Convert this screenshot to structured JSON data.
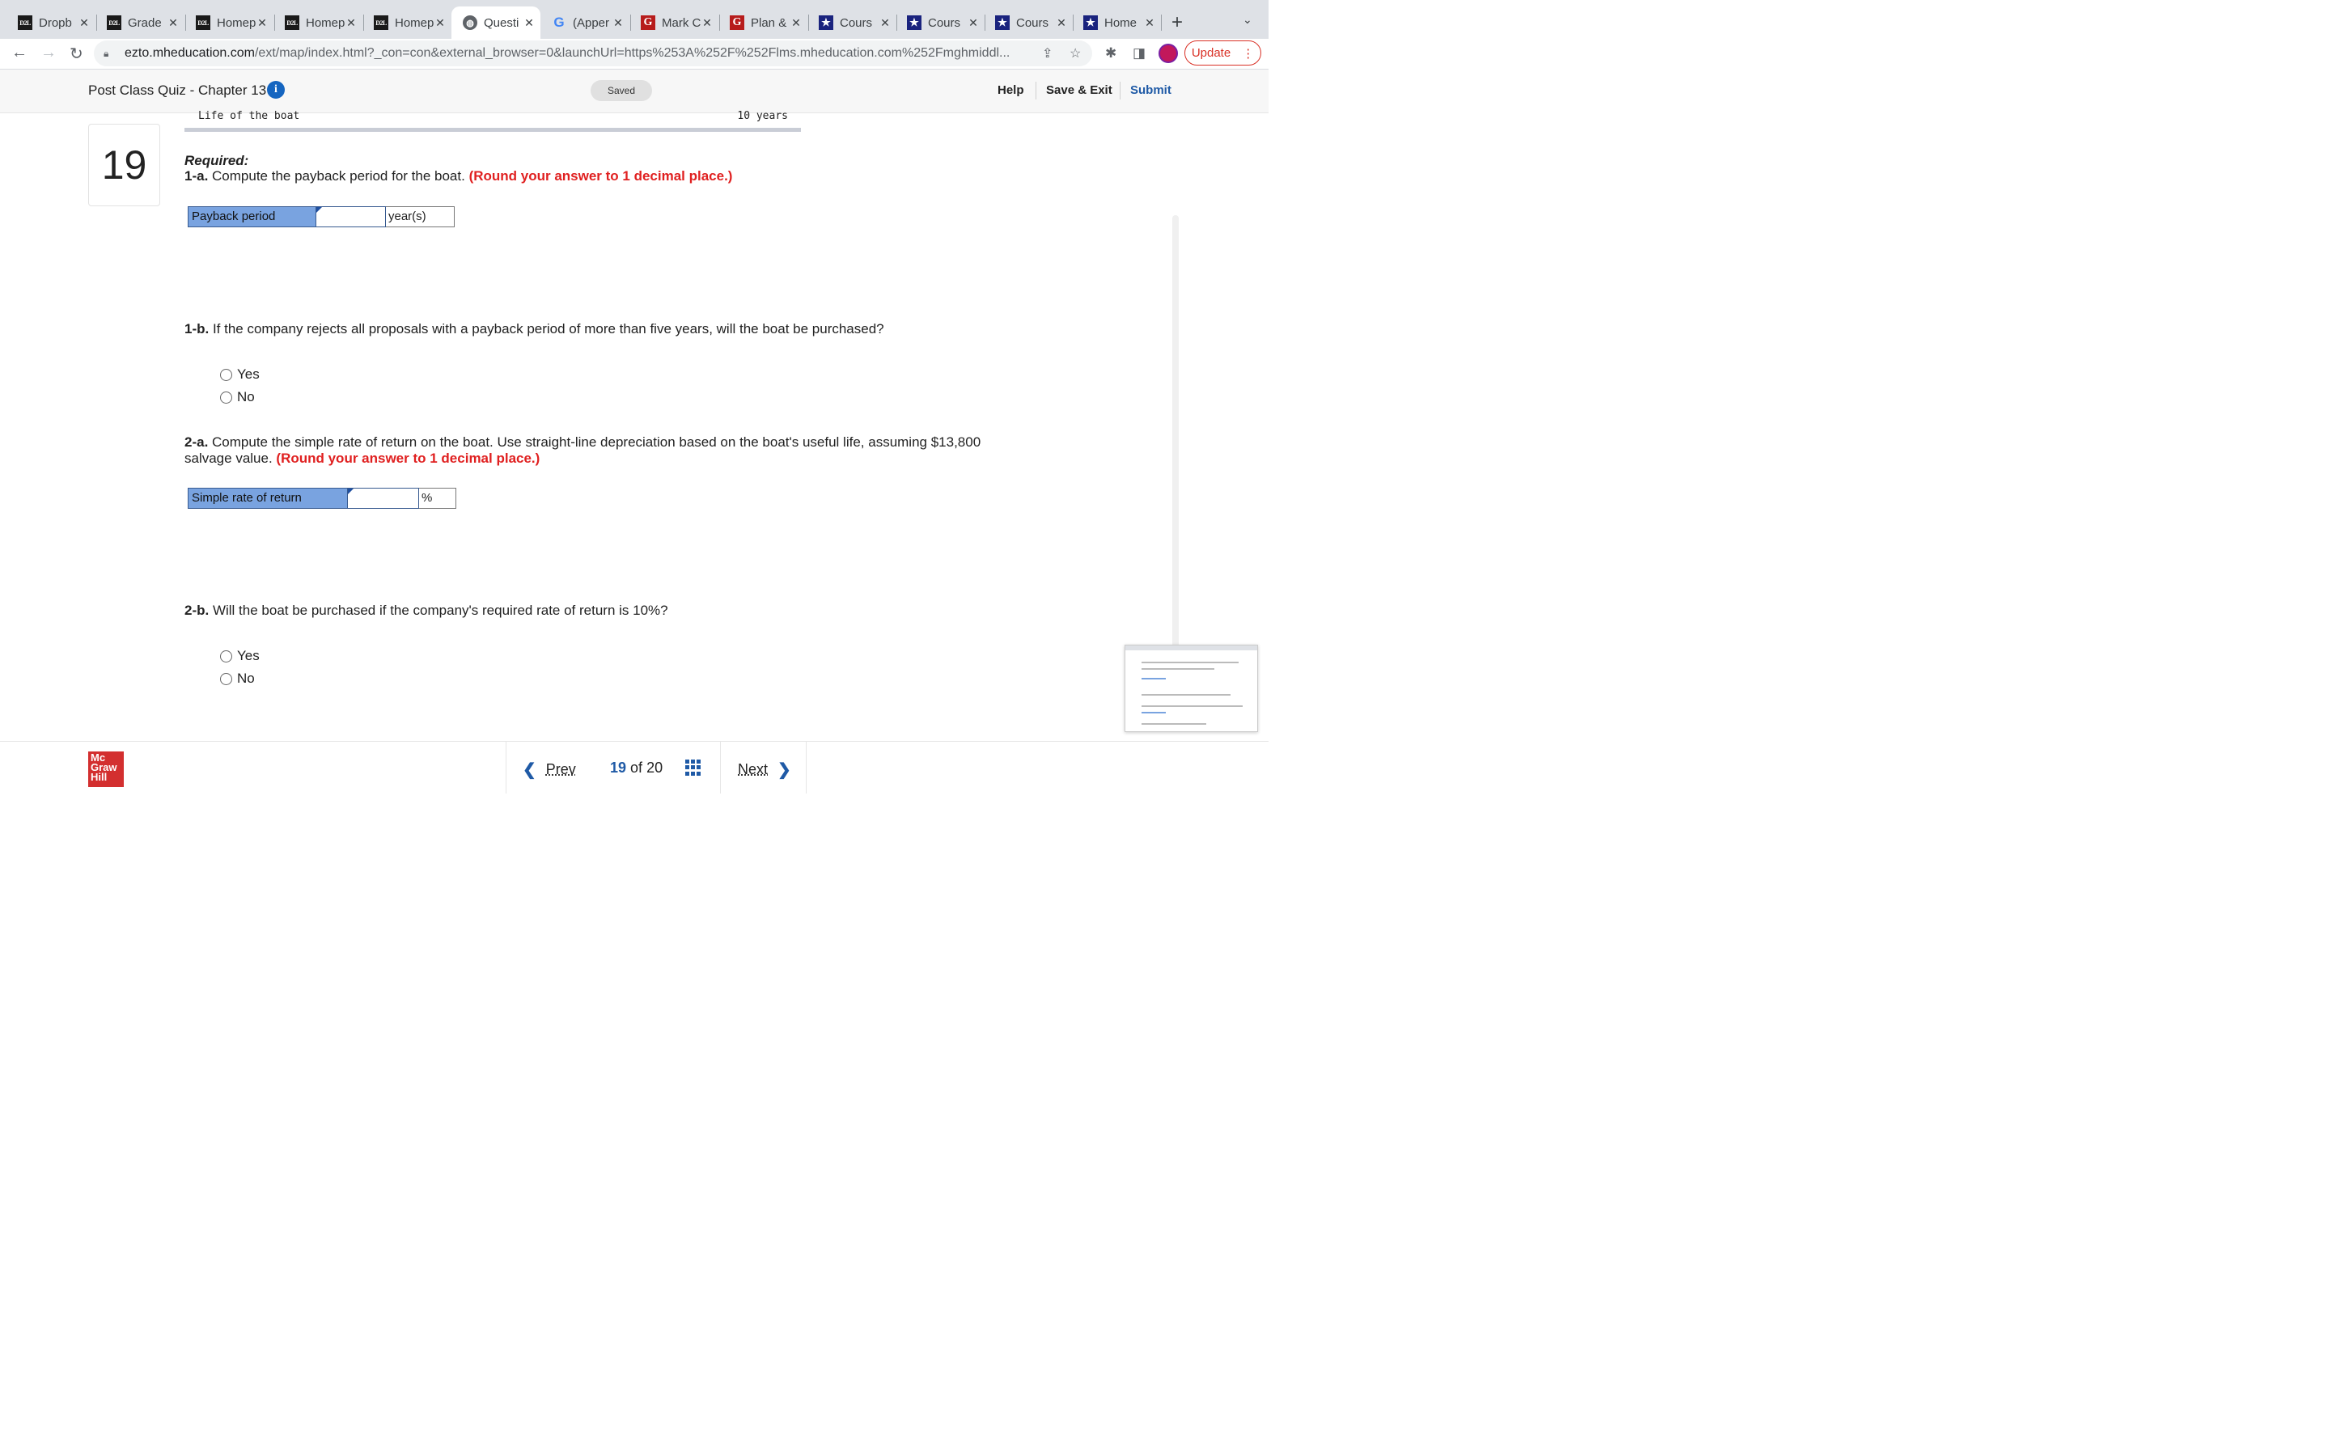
{
  "browser": {
    "tabs": [
      {
        "label": "Dropb",
        "favicon": "d2l"
      },
      {
        "label": "Grade",
        "favicon": "d2l"
      },
      {
        "label": "Homep",
        "favicon": "d2l"
      },
      {
        "label": "Homep",
        "favicon": "d2l"
      },
      {
        "label": "Homep",
        "favicon": "d2l"
      },
      {
        "label": "Questi",
        "favicon": "globe",
        "active": true
      },
      {
        "label": "(Apper",
        "favicon": "google"
      },
      {
        "label": "Mark C",
        "favicon": "g-book"
      },
      {
        "label": "Plan &",
        "favicon": "g-book"
      },
      {
        "label": "Cours",
        "favicon": "star"
      },
      {
        "label": "Cours",
        "favicon": "star"
      },
      {
        "label": "Cours",
        "favicon": "star"
      },
      {
        "label": "Home",
        "favicon": "star"
      }
    ],
    "d2l_text": "D2L",
    "url_domain": "ezto.mheducation.com",
    "url_path": "/ext/map/index.html?_con=con&external_browser=0&launchUrl=https%253A%252F%252Flms.mheducation.com%252Fmghmiddl...",
    "update_label": "Update"
  },
  "header": {
    "title": "Post Class Quiz - Chapter 13",
    "info_glyph": "i",
    "saved_label": "Saved",
    "help": "Help",
    "save_exit": "Save & Exit",
    "submit": "Submit"
  },
  "question": {
    "number": "19",
    "top_row_label": "Life of the boat",
    "top_row_value": "10 years",
    "required": "Required:",
    "q1a_prefix": "1-a.",
    "q1a_text": " Compute the payback period for the boat. ",
    "q1a_hint": "(Round your answer to 1 decimal place.)",
    "payback_label": "Payback period",
    "payback_value": "",
    "payback_unit": "year(s)",
    "q1b_prefix": "1-b.",
    "q1b_text": " If the company rejects all proposals with a payback period of more than five years, will the boat be purchased?",
    "q1b_options": [
      "Yes",
      "No"
    ],
    "q2a_prefix": "2-a.",
    "q2a_text_line1": " Compute the simple rate of return on the boat. Use straight-line depreciation based on the boat's useful life, assuming $13,800",
    "q2a_text_line2": "salvage value. ",
    "q2a_hint": "(Round your answer to 1 decimal place.)",
    "srr_label": "Simple rate of return",
    "srr_value": "",
    "srr_unit": "%",
    "q2b_prefix": "2-b.",
    "q2b_text": " Will the boat be purchased if the company's required rate of return is 10%?",
    "q2b_options": [
      "Yes",
      "No"
    ]
  },
  "footer": {
    "logo_lines": [
      "Mc",
      "Graw",
      "Hill"
    ],
    "prev": "Prev",
    "current": "19",
    "of": "of",
    "total": "20",
    "next": "Next"
  },
  "colors": {
    "accent": "#1f5aa6",
    "hint_red": "#e02020",
    "label_blue": "#79a3e0",
    "logo_red": "#d32f2f"
  }
}
